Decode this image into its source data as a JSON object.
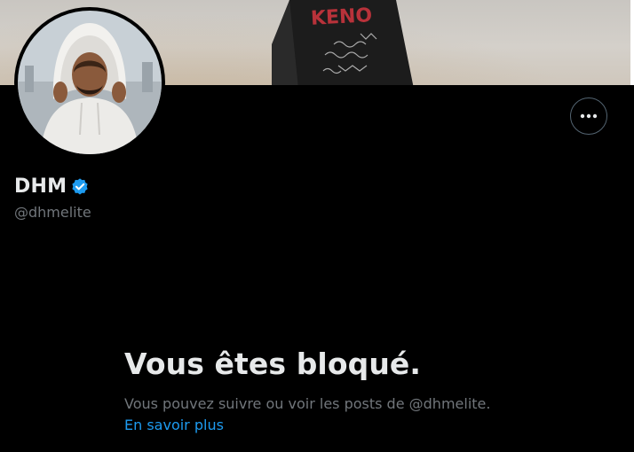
{
  "profile": {
    "display_name": "DHM",
    "handle": "@dhmelite",
    "verified_icon": "verified-badge-icon",
    "avatar_icon": "avatar-photo"
  },
  "banner": {
    "shirt_text": "KENO"
  },
  "actions": {
    "more_icon": "more-dots-icon"
  },
  "blocked": {
    "title": "Vous êtes bloqué.",
    "description": "Vous pouvez suivre ou voir les posts de @dhmelite.",
    "learn_more": "En savoir plus"
  },
  "colors": {
    "background": "#000000",
    "primary_text": "#e7e9ea",
    "secondary_text": "#71767b",
    "accent": "#1d9bf0",
    "border": "#536471"
  }
}
